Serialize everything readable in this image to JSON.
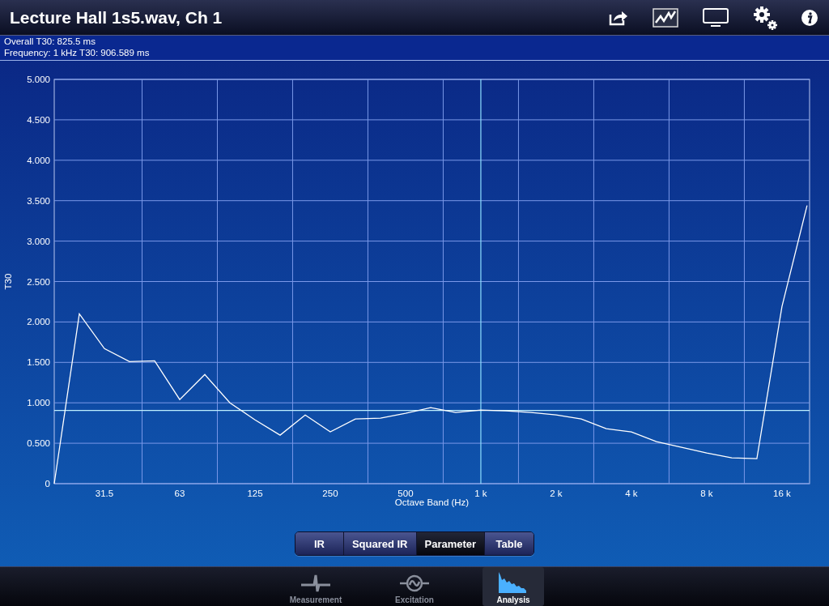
{
  "header": {
    "title": "Lecture Hall 1s5.wav, Ch 1"
  },
  "info": [
    "Overall T30:  825.5 ms",
    "Frequency: 1 kHz T30: 906.589 ms"
  ],
  "chart_data": {
    "type": "line",
    "xlabel": "Octave Band (Hz)",
    "ylabel": "T30",
    "categories": [
      null,
      null,
      "31.5",
      null,
      null,
      "63",
      null,
      null,
      "125",
      null,
      null,
      "250",
      null,
      null,
      "500",
      null,
      null,
      "1 k",
      null,
      null,
      "2 k",
      null,
      null,
      "4 k",
      null,
      null,
      "8 k",
      null,
      null,
      "16 k",
      null
    ],
    "series": [
      {
        "color": "#ffffff",
        "values": [
          0,
          2.1,
          1.67,
          1.51,
          1.52,
          1.04,
          1.35,
          1.0,
          0.79,
          0.6,
          0.85,
          0.64,
          0.8,
          0.81,
          0.87,
          0.94,
          0.88,
          0.91,
          0.9,
          0.88,
          0.85,
          0.8,
          0.68,
          0.64,
          0.52,
          0.45,
          0.38,
          0.32,
          0.31,
          2.19,
          3.44
        ]
      }
    ],
    "ylim": [
      0,
      5
    ],
    "yticks": [
      {
        "value": 0,
        "label": "0"
      },
      {
        "value": 0.5,
        "label": "0.500"
      },
      {
        "value": 1,
        "label": "1.000"
      },
      {
        "value": 1.5,
        "label": "1.500"
      },
      {
        "value": 2,
        "label": "2.000"
      },
      {
        "value": 2.5,
        "label": "2.500"
      },
      {
        "value": 3,
        "label": "3.000"
      },
      {
        "value": 3.5,
        "label": "3.500"
      },
      {
        "value": 4,
        "label": "4.000"
      },
      {
        "value": 4.5,
        "label": "4.500"
      },
      {
        "value": 5,
        "label": "5.000"
      }
    ],
    "grid": true,
    "ref_lines": [
      {
        "axis": "x",
        "value": "1 k"
      },
      {
        "axis": "y",
        "value": 0.906
      }
    ]
  },
  "segments": [
    {
      "label": "IR",
      "selected": false
    },
    {
      "label": "Squared IR",
      "selected": false
    },
    {
      "label": "Parameter",
      "selected": true
    },
    {
      "label": "Table",
      "selected": false
    }
  ],
  "tabbar": [
    {
      "label": "Measurement",
      "kind": "pulse",
      "selected": false
    },
    {
      "label": "Excitation",
      "kind": "sine",
      "selected": false
    },
    {
      "label": "Analysis",
      "kind": "decay",
      "selected": true
    }
  ]
}
